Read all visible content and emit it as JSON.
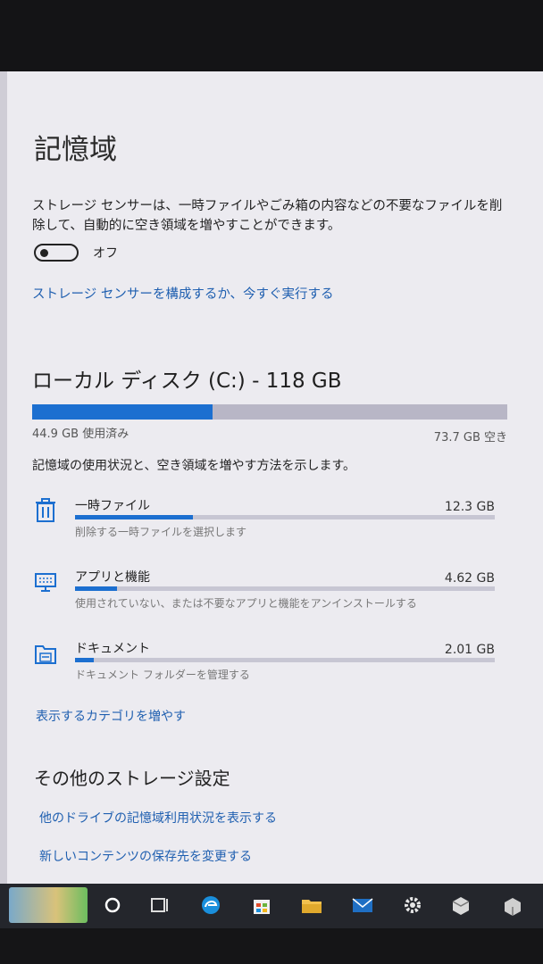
{
  "settings": {
    "page_title": "記憶域",
    "storage_sense_description": "ストレージ センサーは、一時ファイルやごみ箱の内容などの不要なファイルを削除して、自動的に空き領域を増やすことができます。",
    "toggle_state": "オフ",
    "configure_link": "ストレージ センサーを構成するか、今すぐ実行する"
  },
  "disk": {
    "title": "ローカル ディスク (C:) - 118 GB",
    "used_label": "44.9 GB 使用済み",
    "free_label": "73.7 GB 空き",
    "used_fraction": 0.38,
    "usage_description": "記憶域の使用状況と、空き領域を増やす方法を示します。"
  },
  "categories": [
    {
      "name": "一時ファイル",
      "size": "12.3 GB",
      "description": "削除する一時ファイルを選択します",
      "fill": 0.28,
      "icon": "trash-icon"
    },
    {
      "name": "アプリと機能",
      "size": "4.62 GB",
      "description": "使用されていない、または不要なアプリと機能をアンインストールする",
      "fill": 0.1,
      "icon": "monitor-apps-icon"
    },
    {
      "name": "ドキュメント",
      "size": "2.01 GB",
      "description": "ドキュメント フォルダーを管理する",
      "fill": 0.045,
      "icon": "documents-icon"
    }
  ],
  "more_categories_link": "表示するカテゴリを増やす",
  "other": {
    "title": "その他のストレージ設定",
    "links": [
      "他のドライブの記憶域利用状況を表示する",
      "新しいコンテンツの保存先を変更する"
    ]
  },
  "taskbar": {
    "icons": [
      "cortana-icon",
      "task-view-icon",
      "edge-icon",
      "store-icon",
      "file-explorer-icon",
      "mail-icon",
      "settings-gear-icon",
      "app-box-icon",
      "app-box-2-icon"
    ]
  },
  "colors": {
    "accent": "#1c6fd0",
    "link": "#1f5fb0",
    "background": "#ecebf0"
  }
}
